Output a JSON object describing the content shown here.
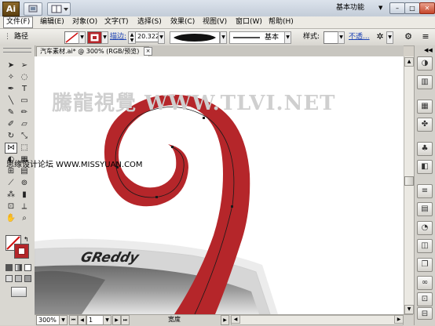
{
  "app": {
    "logo_text": "Ai",
    "workspace": "基本功能",
    "window_buttons": [
      "–",
      "□",
      "✕"
    ]
  },
  "menu": [
    "文件(F)",
    "编辑(E)",
    "对象(O)",
    "文字(T)",
    "选择(S)",
    "效果(C)",
    "视图(V)",
    "窗口(W)",
    "帮助(H)"
  ],
  "control_bar": {
    "selection_type": "路径",
    "stroke_link": "描边:",
    "stroke_weight": "20.322",
    "brush_label": "基本",
    "style_label": "样式:",
    "opacity_link": "不透..."
  },
  "document_tab": {
    "title": "汽车素材.ai* @ 300% (RGB/预览)",
    "close": "×"
  },
  "canvas": {
    "watermark": "騰龍視覺 WWW.TLVI.NET",
    "side_watermark": "思缘设计论坛 WWW.MISSYUAN.COM",
    "logo_text": "GReddy",
    "curl_color": "#b5262a"
  },
  "status_bar": {
    "zoom": "300%",
    "page": "1",
    "label": "宽度"
  },
  "tools": {
    "icons": [
      "selection-icon",
      "direct-selection-icon",
      "magic-wand-icon",
      "lasso-icon",
      "pen-icon",
      "type-icon",
      "line-icon",
      "rectangle-icon",
      "paintbrush-icon",
      "pencil-icon",
      "blob-brush-icon",
      "eraser-icon",
      "rotate-icon",
      "scale-icon",
      "width-icon",
      "free-transform-icon",
      "shape-builder-icon",
      "perspective-icon",
      "mesh-icon",
      "gradient-icon",
      "eyedropper-icon",
      "blend-icon",
      "symbol-sprayer-icon",
      "column-graph-icon",
      "artboard-icon",
      "slice-icon",
      "hand-icon",
      "zoom-icon"
    ]
  },
  "dock": {
    "icons": [
      "color-icon",
      "color-guide-icon",
      "swatches-icon",
      "brushes-icon",
      "symbols-icon",
      "graphic-styles-icon",
      "stroke-icon",
      "gradient-icon",
      "transparency-icon",
      "appearance-icon",
      "layers-icon",
      "links-icon",
      "artboards-icon",
      "align-icon",
      "transform-icon",
      "pathfinder-icon"
    ]
  }
}
